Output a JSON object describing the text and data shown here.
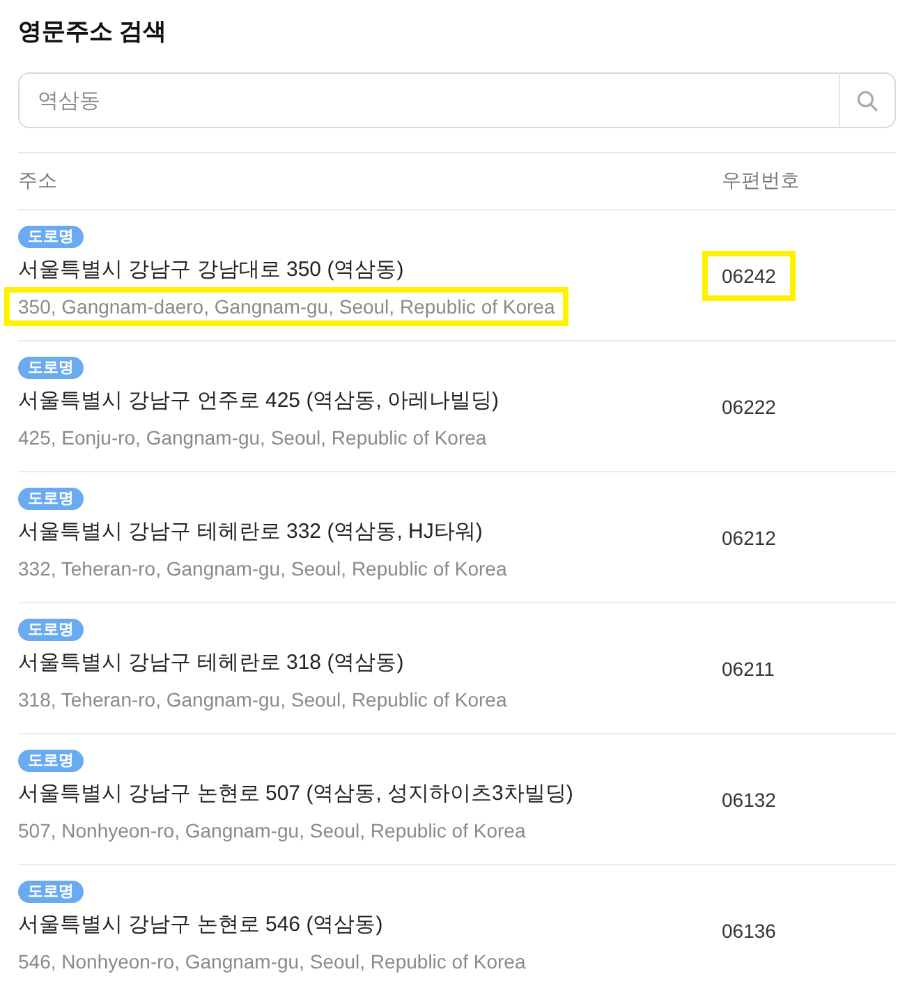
{
  "title": "영문주소 검색",
  "search": {
    "value": "역삼동"
  },
  "table": {
    "columns": [
      "주소",
      "우편번호"
    ],
    "rows": [
      {
        "badge": "도로명",
        "korean": "서울특별시 강남구 강남대로 350 (역삼동)",
        "english": "350, Gangnam-daero, Gangnam-gu, Seoul, Republic of Korea",
        "zip": "06242",
        "highlighted": true
      },
      {
        "badge": "도로명",
        "korean": "서울특별시 강남구 언주로 425 (역삼동, 아레나빌딩)",
        "english": "425, Eonju-ro, Gangnam-gu, Seoul, Republic of Korea",
        "zip": "06222",
        "highlighted": false
      },
      {
        "badge": "도로명",
        "korean": "서울특별시 강남구 테헤란로 332 (역삼동, HJ타워)",
        "english": "332, Teheran-ro, Gangnam-gu, Seoul, Republic of Korea",
        "zip": "06212",
        "highlighted": false
      },
      {
        "badge": "도로명",
        "korean": "서울특별시 강남구 테헤란로 318 (역삼동)",
        "english": "318, Teheran-ro, Gangnam-gu, Seoul, Republic of Korea",
        "zip": "06211",
        "highlighted": false
      },
      {
        "badge": "도로명",
        "korean": "서울특별시 강남구 논현로 507 (역삼동, 성지하이츠3차빌딩)",
        "english": "507, Nonhyeon-ro, Gangnam-gu, Seoul, Republic of Korea",
        "zip": "06132",
        "highlighted": false
      },
      {
        "badge": "도로명",
        "korean": "서울특별시 강남구 논현로 546 (역삼동)",
        "english": "546, Nonhyeon-ro, Gangnam-gu, Seoul, Republic of Korea",
        "zip": "06136",
        "highlighted": false
      }
    ]
  }
}
